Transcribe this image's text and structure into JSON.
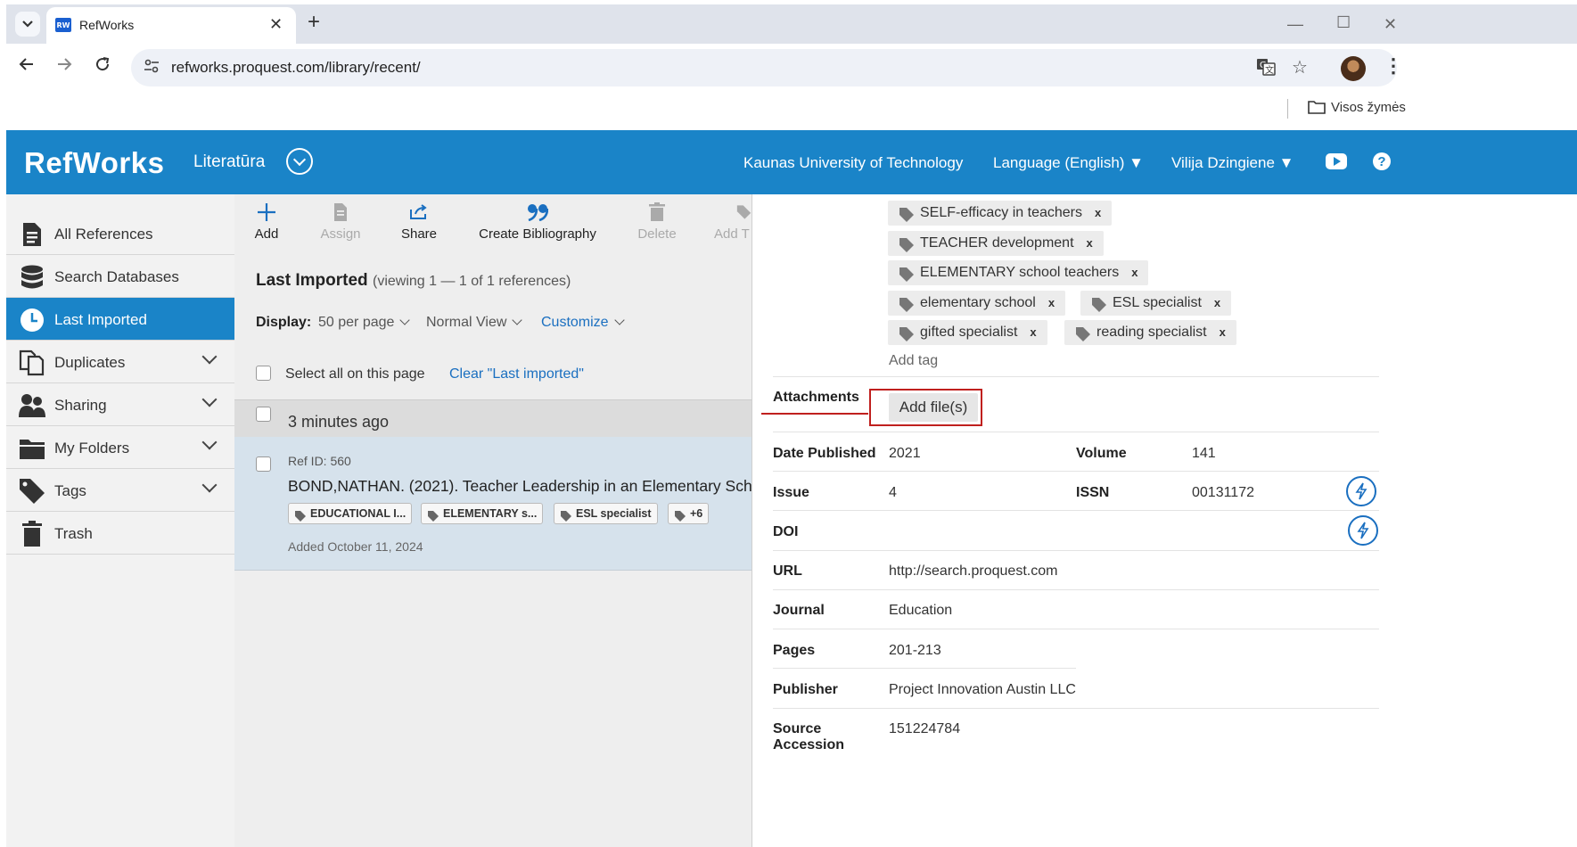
{
  "browser": {
    "tab_title": "RefWorks",
    "favicon_text": "RW",
    "url": "refworks.proquest.com/library/recent/",
    "bookmarks_label": "Visos žymės"
  },
  "header": {
    "logo": "RefWorks",
    "project": "Literatūra",
    "institution": "Kaunas University of Technology",
    "language": "Language (English) ▼",
    "user": "Vilija Dzingiene ▼",
    "brand_color": "#1a84c8"
  },
  "sidebar": {
    "items": [
      {
        "label": "All References",
        "icon": "document-icon"
      },
      {
        "label": "Search Databases",
        "icon": "database-icon"
      },
      {
        "label": "Last Imported",
        "icon": "clock-icon",
        "active": true
      },
      {
        "label": "Duplicates",
        "icon": "duplicates-icon"
      },
      {
        "label": "Sharing",
        "icon": "users-icon"
      },
      {
        "label": "My Folders",
        "icon": "folder-icon"
      },
      {
        "label": "Tags",
        "icon": "tag-icon"
      },
      {
        "label": "Trash",
        "icon": "trash-icon"
      }
    ]
  },
  "toolbar": {
    "add": "Add",
    "assign": "Assign",
    "share": "Share",
    "create_bibliography": "Create Bibliography",
    "delete": "Delete",
    "add_tag": "Add T"
  },
  "list": {
    "title": "Last Imported",
    "viewing": "(viewing 1 — 1 of 1 references)",
    "display_label": "Display:",
    "per_page": "50 per page",
    "view_mode": "Normal View",
    "customize": "Customize",
    "select_all": "Select all on this page",
    "clear": "Clear \"Last imported\"",
    "group_time": "3 minutes ago",
    "ref": {
      "ref_id": "Ref ID: 560",
      "citation": "BOND,NATHAN. (2021). Teacher Leadership in an Elementary Sch",
      "tags": [
        "EDUCATIONAL I...",
        "ELEMENTARY s...",
        "ESL specialist",
        "+6"
      ],
      "added": "Added October 11, 2024"
    }
  },
  "detail": {
    "tags": [
      "SELF-efficacy in teachers",
      "TEACHER development",
      "ELEMENTARY school teachers",
      "elementary school",
      "ESL specialist",
      "gifted specialist",
      "reading specialist"
    ],
    "add_tag": "Add tag",
    "attachments_label": "Attachments",
    "add_files": "Add file(s)",
    "fields": {
      "date_published_label": "Date Published",
      "date_published": "2021",
      "volume_label": "Volume",
      "volume": "141",
      "issue_label": "Issue",
      "issue": "4",
      "issn_label": "ISSN",
      "issn": "00131172",
      "doi_label": "DOI",
      "url_label": "URL",
      "url": "http://search.proquest.com",
      "journal_label": "Journal",
      "journal": "Education",
      "pages_label": "Pages",
      "pages": "201-213",
      "publisher_label": "Publisher",
      "publisher": "Project Innovation Austin LLC",
      "source_label": "Source Accession",
      "source": "151224784"
    }
  }
}
